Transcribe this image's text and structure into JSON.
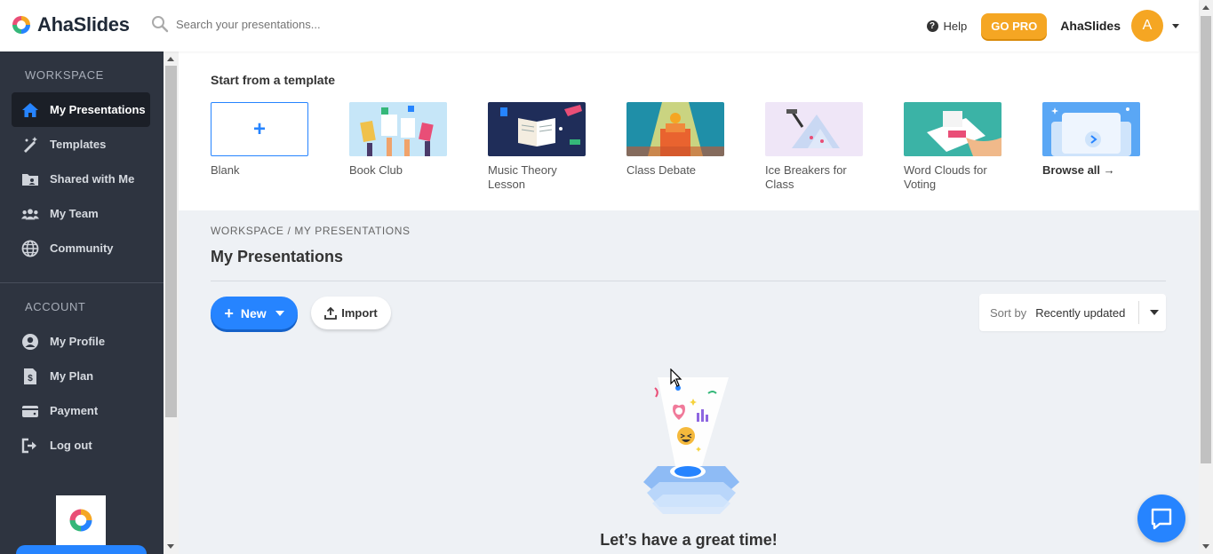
{
  "app": {
    "name": "AhaSlides"
  },
  "search": {
    "placeholder": "Search your presentations..."
  },
  "header": {
    "help_label": "Help",
    "gopro_label": "GO PRO",
    "account_name": "AhaSlides",
    "avatar_initial": "A"
  },
  "sidebar": {
    "workspace_heading": "WORKSPACE",
    "workspace_items": [
      {
        "label": "My Presentations",
        "icon": "home-icon",
        "active": true
      },
      {
        "label": "Templates",
        "icon": "magic-wand-icon"
      },
      {
        "label": "Shared with Me",
        "icon": "shared-folder-icon"
      },
      {
        "label": "My Team",
        "icon": "team-icon"
      },
      {
        "label": "Community",
        "icon": "globe-icon"
      }
    ],
    "account_heading": "ACCOUNT",
    "account_items": [
      {
        "label": "My Profile",
        "icon": "user-circle-icon"
      },
      {
        "label": "My Plan",
        "icon": "invoice-icon"
      },
      {
        "label": "Payment",
        "icon": "wallet-icon"
      },
      {
        "label": "Log out",
        "icon": "logout-icon"
      }
    ]
  },
  "templates": {
    "title": "Start from a template",
    "items": [
      {
        "label": "Blank"
      },
      {
        "label": "Book Club"
      },
      {
        "label": "Music Theory Lesson"
      },
      {
        "label": "Class Debate"
      },
      {
        "label": "Ice Breakers for Class"
      },
      {
        "label": "Word Clouds for Voting"
      },
      {
        "label": "Browse all →"
      }
    ]
  },
  "breadcrumb": "WORKSPACE  /  MY PRESENTATIONS",
  "page_title": "My Presentations",
  "actions": {
    "new_label": "New",
    "import_label": "Import"
  },
  "sort": {
    "label": "Sort by",
    "value": "Recently updated"
  },
  "empty_state": {
    "text": "Let’s have a great time!"
  },
  "colors": {
    "accent": "#2684ff",
    "sidebar_bg": "#2e3440",
    "gopro": "#f5a623"
  }
}
